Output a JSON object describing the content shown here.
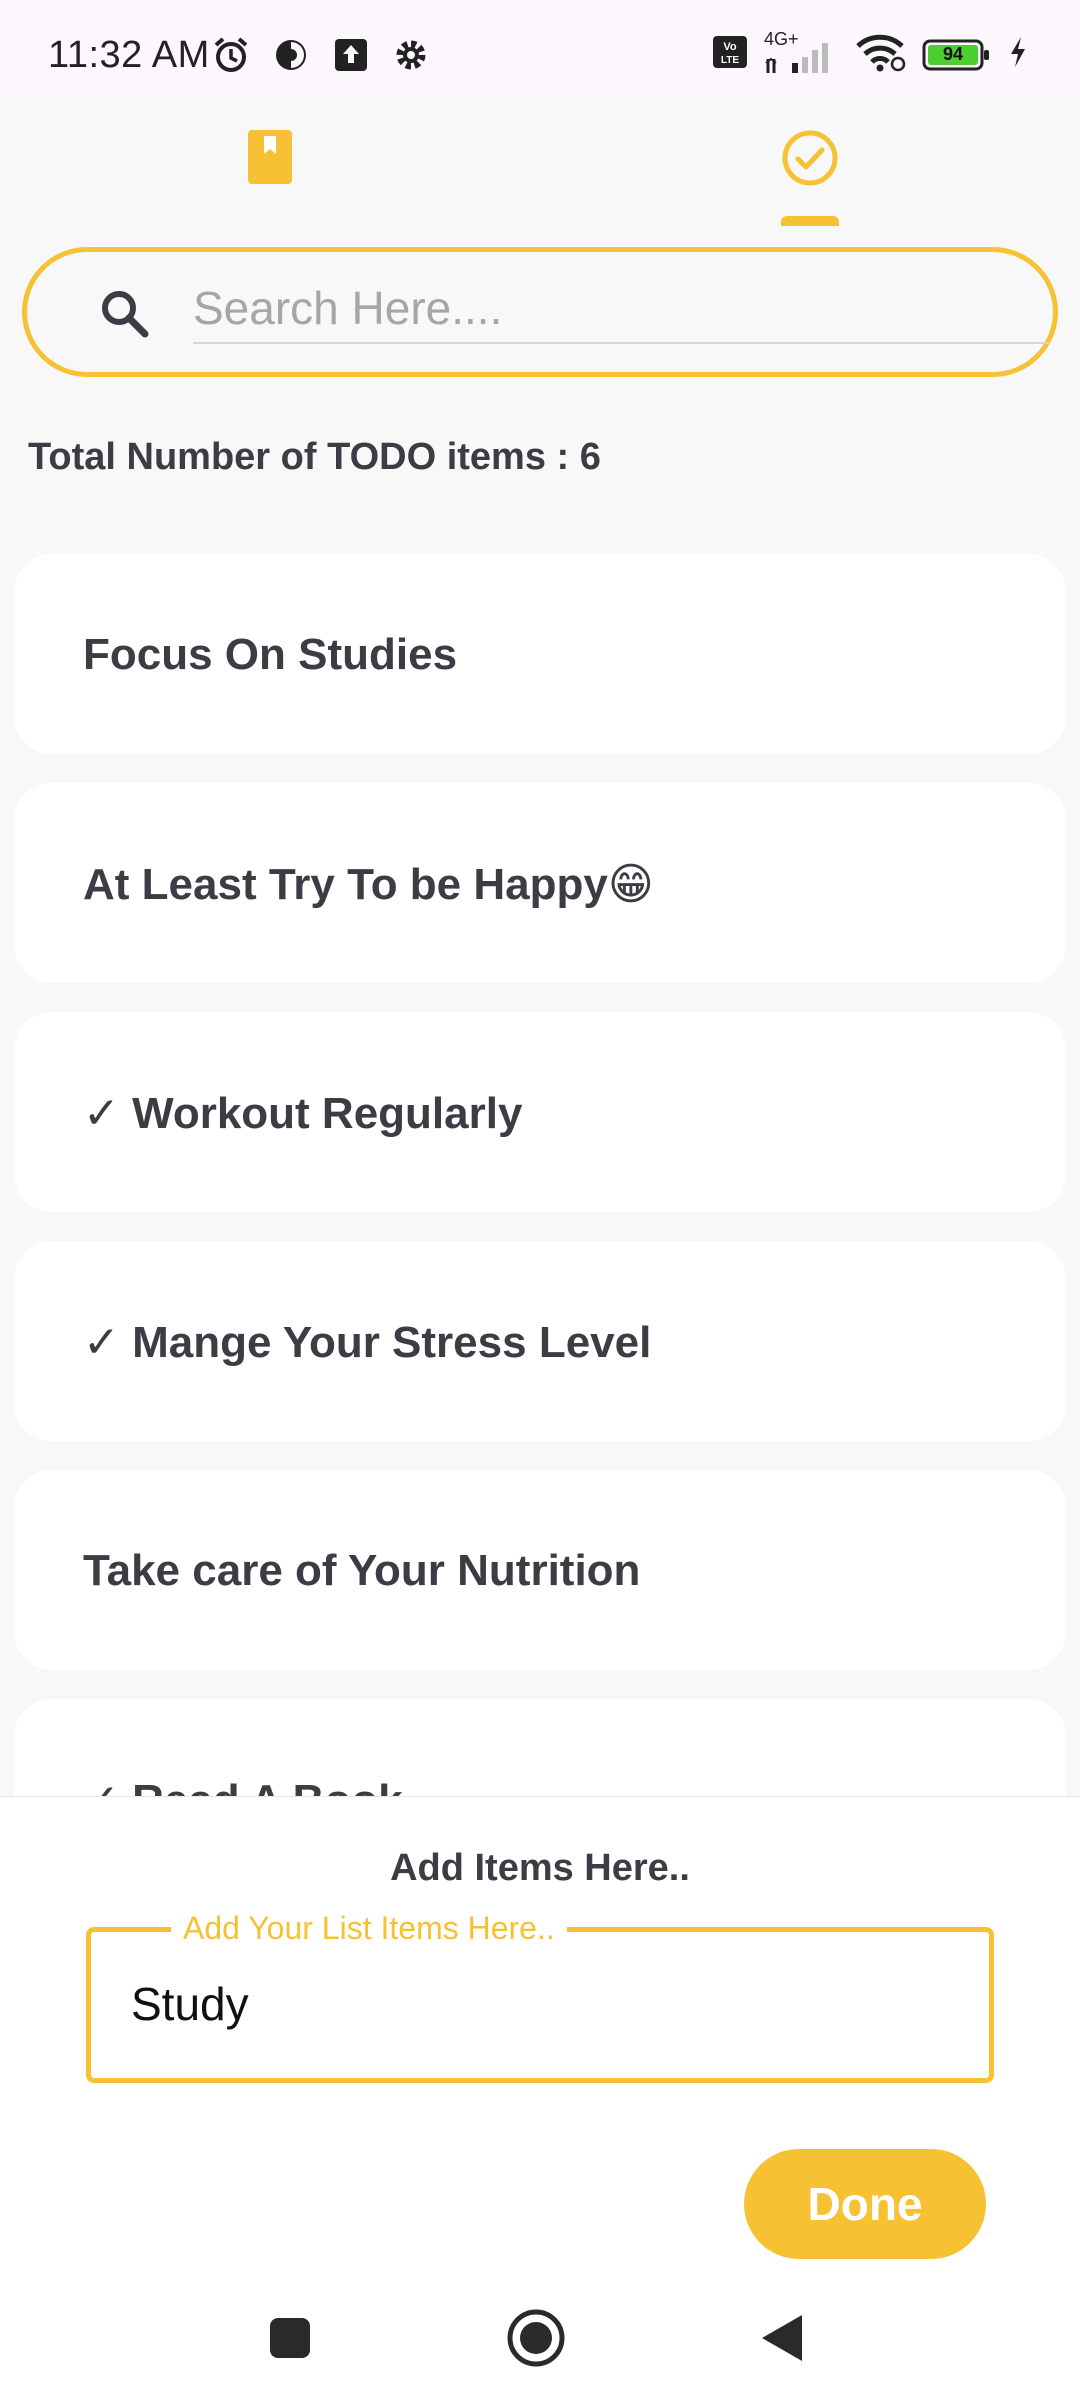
{
  "status_bar": {
    "time": "11:32 AM",
    "battery": "94",
    "network": "4G+",
    "icons": [
      "alarm-icon",
      "data-saver-icon",
      "upload-icon",
      "settings-icon",
      "volte-icon",
      "signal-icon",
      "wifi-icon",
      "battery-icon",
      "charging-icon"
    ]
  },
  "tabs": [
    {
      "icon": "bookmark-icon",
      "selected": false
    },
    {
      "icon": "check-circle-icon",
      "selected": true
    }
  ],
  "search": {
    "placeholder": "Search Here....",
    "value": ""
  },
  "summary": {
    "total_label": "Total Number of TODO items : 6"
  },
  "todos": [
    {
      "text": "Focus On Studies"
    },
    {
      "text": "At Least Try To be Happy😁"
    },
    {
      "text": "✓ Workout Regularly"
    },
    {
      "text": "✓ Mange Your Stress Level"
    },
    {
      "text": "Take care of Your Nutrition"
    },
    {
      "text": "✓ Read A Book"
    }
  ],
  "add_sheet": {
    "title": "Add Items Here..",
    "field_label": "Add Your List Items Here..",
    "field_value": "Study",
    "done_label": "Done"
  },
  "nav": {
    "icons": [
      "recents-icon",
      "home-icon",
      "back-icon"
    ]
  },
  "colors": {
    "accent": "#f6c234",
    "text": "#3c3c44",
    "background": "#f8f8f8",
    "card": "#ffffff"
  }
}
